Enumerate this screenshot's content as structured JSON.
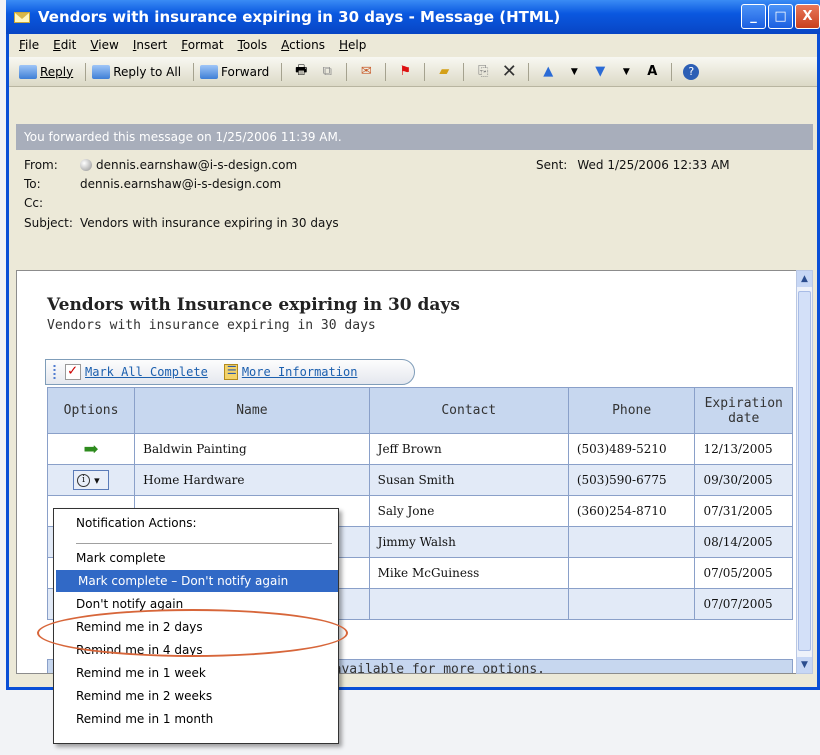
{
  "window": {
    "title": "Vendors with insurance expiring in 30 days - Message (HTML)",
    "buttons": [
      "_",
      "□",
      "X"
    ]
  },
  "menubar": [
    "File",
    "Edit",
    "View",
    "Insert",
    "Format",
    "Tools",
    "Actions",
    "Help"
  ],
  "toolbar": {
    "reply": "Reply",
    "reply_all": "Reply to All",
    "forward": "Forward"
  },
  "info_bar": "You forwarded this message on 1/25/2006 11:39 AM.",
  "header": {
    "from_label": "From:",
    "from": "dennis.earnshaw@i-s-design.com",
    "to_label": "To:",
    "to": "dennis.earnshaw@i-s-design.com",
    "cc_label": "Cc:",
    "subject_label": "Subject:",
    "subject": "Vendors with insurance expiring in 30 days",
    "sent_label": "Sent:",
    "sent": "Wed 1/25/2006 12:33 AM"
  },
  "message": {
    "title": "Vendors with Insurance expiring in 30 days",
    "subtitle": "Vendors with insurance expiring in 30 days",
    "mark_all_complete": "Mark All Complete",
    "more_information": "More Information",
    "columns": [
      "Options",
      "Name",
      "Contact",
      "Phone",
      "Expiration date"
    ],
    "rows": [
      {
        "name": "Baldwin Painting",
        "contact": "Jeff Brown",
        "phone": "(503)489-5210",
        "date": "12/13/2005"
      },
      {
        "name": "Home Hardware",
        "contact": "Susan Smith",
        "phone": "(503)590-6775",
        "date": "09/30/2005"
      },
      {
        "name": "",
        "contact": "Saly Jone",
        "phone": "(360)254-8710",
        "date": "07/31/2005"
      },
      {
        "name": "",
        "contact": "Jimmy Walsh",
        "phone": "",
        "date": "08/14/2005"
      },
      {
        "name": "",
        "contact": "Mike McGuiness",
        "phone": "",
        "date": "07/05/2005"
      },
      {
        "name": "",
        "contact": "",
        "phone": "",
        "date": "07/07/2005"
      }
    ],
    "footer_note": "n available for more options."
  },
  "context_menu": {
    "header": "Notification Actions:",
    "items": [
      "Mark complete",
      "Mark complete – Don't notify again",
      "Don't notify again",
      "Remind me in 2 days",
      "Remind me in 4 days",
      "Remind me in 1 week",
      "Remind me in 2 weeks",
      "Remind me in 1 month"
    ],
    "highlighted_index": 1
  },
  "colors": {
    "titlebar": "#0a58e0",
    "menu_highlight": "#3169c6",
    "callout_oval": "#d7663a",
    "table_header": "#c7d7ef"
  },
  "icons": [
    "envelope-icon",
    "reply-icon",
    "reply-all-icon",
    "forward-icon",
    "print-icon",
    "delete-icon",
    "flag-icon",
    "help-icon",
    "arrow-right-icon",
    "info-icon"
  ]
}
